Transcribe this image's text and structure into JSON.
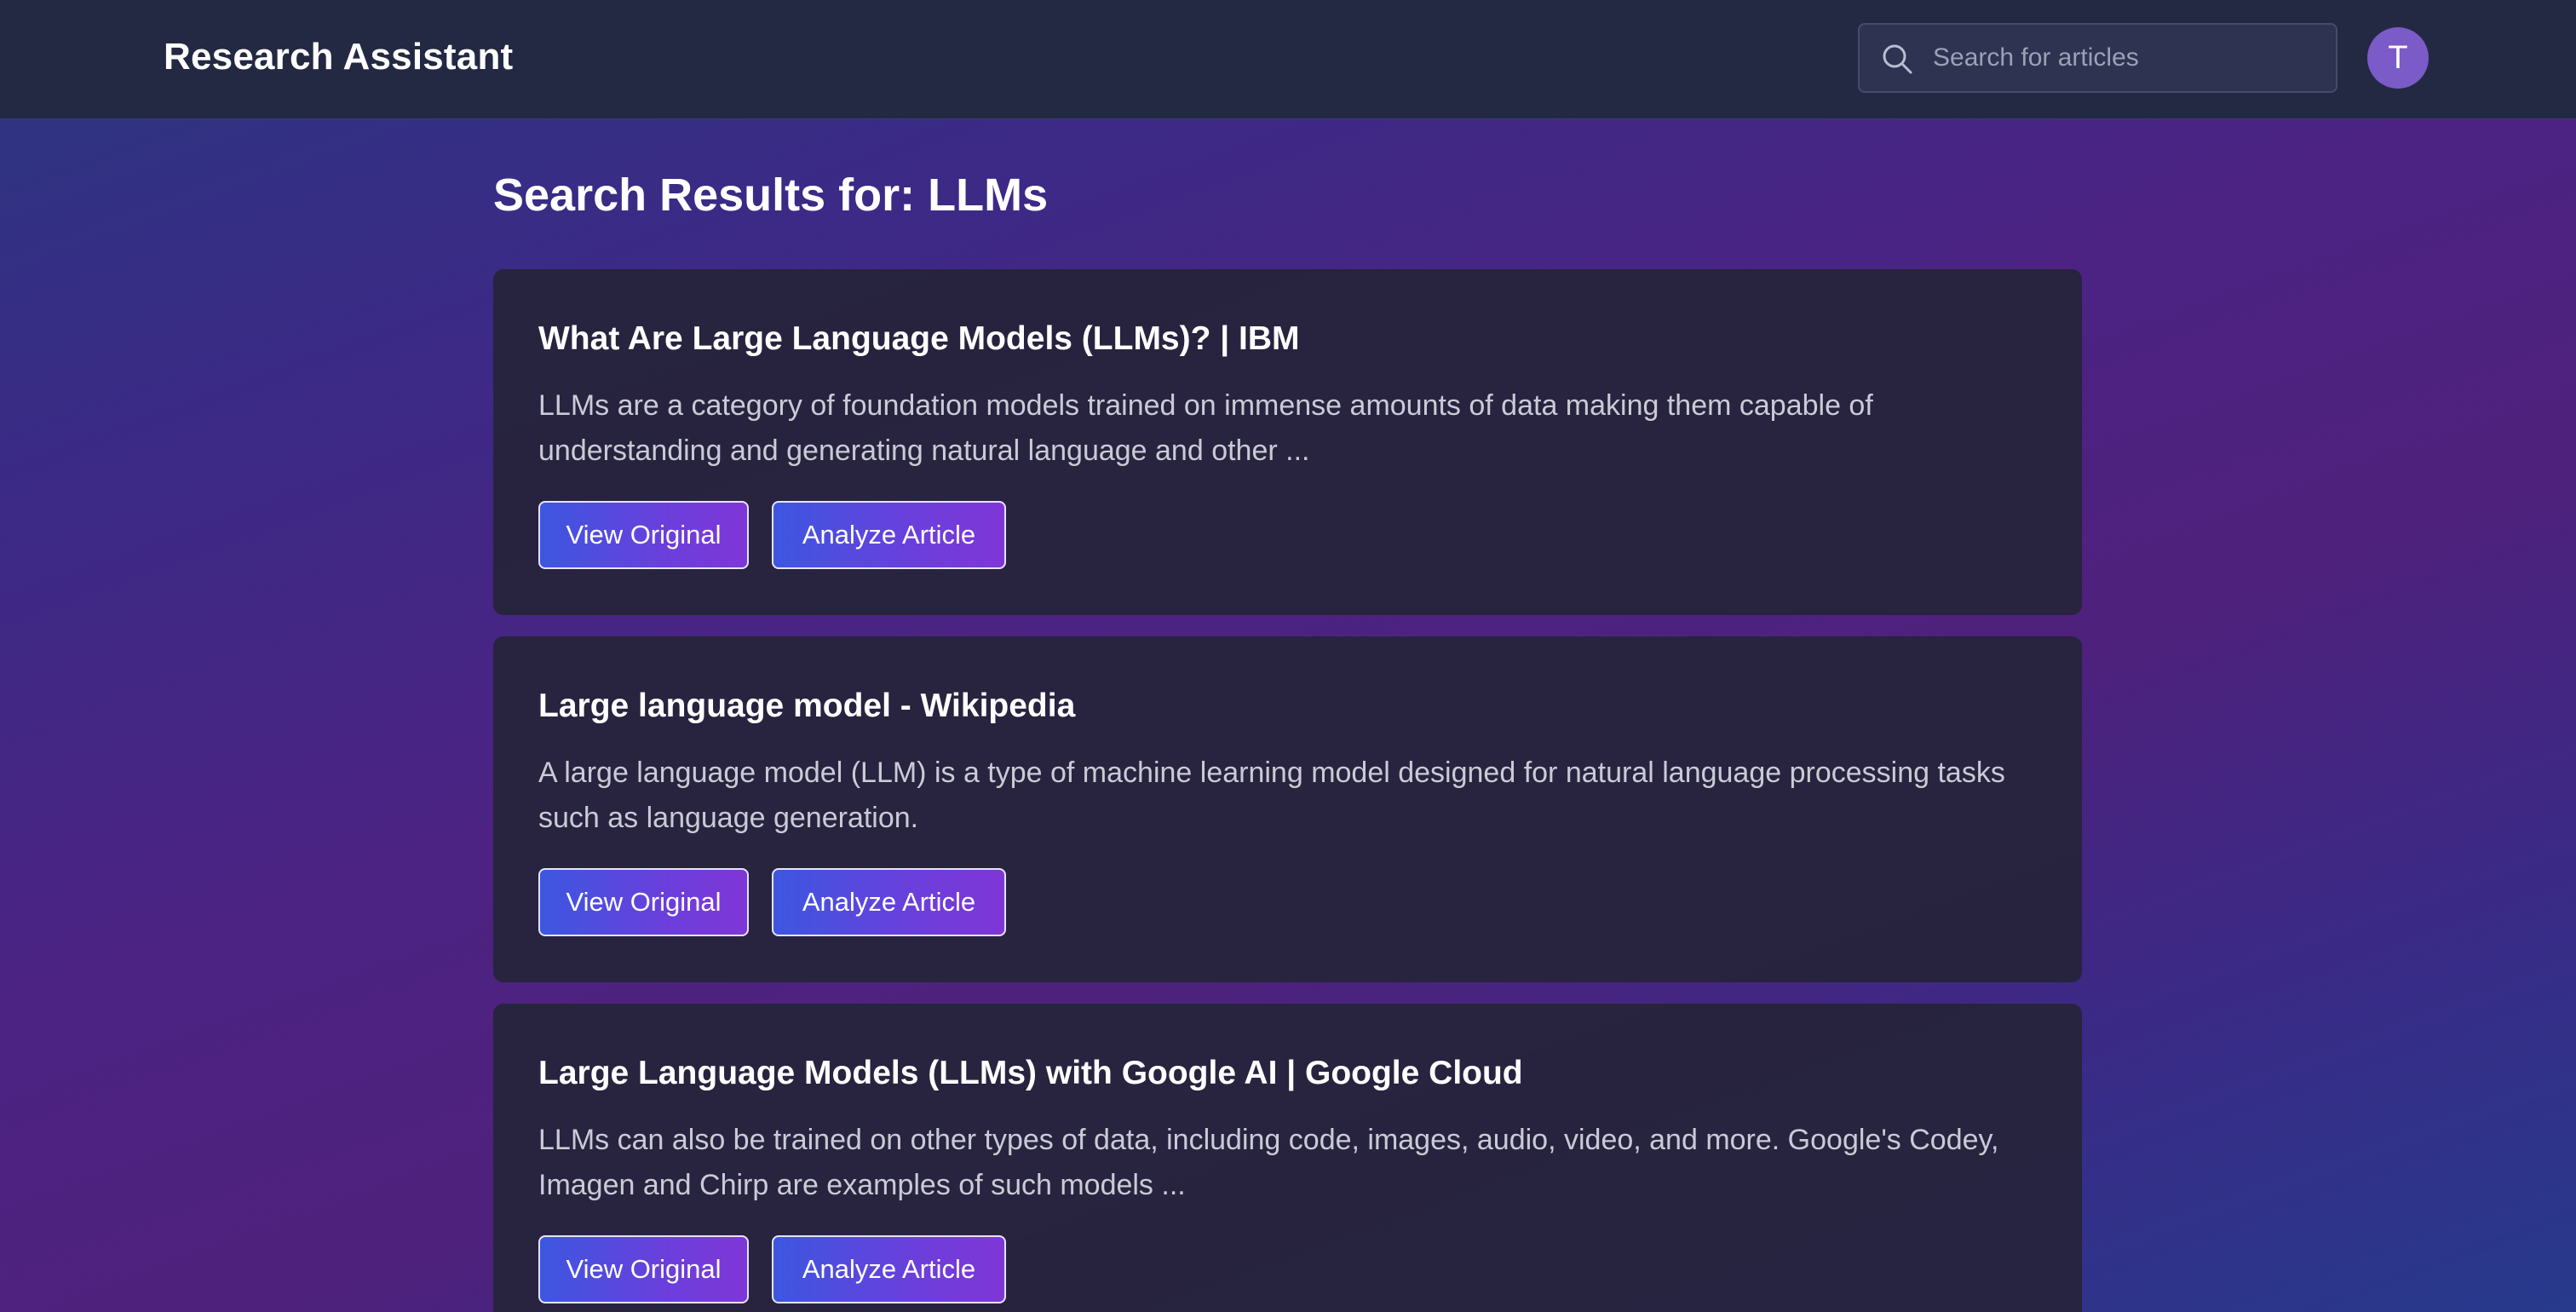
{
  "header": {
    "brand": "Research Assistant",
    "search_placeholder": "Search for articles",
    "avatar_initial": "T"
  },
  "page": {
    "title": "Search Results for: LLMs"
  },
  "results": [
    {
      "title": "What Are Large Language Models (LLMs)? | IBM",
      "snippet": "LLMs are a category of foundation models trained on immense amounts of data making them capable of understanding and generating natural language and other ...",
      "view_label": "View Original",
      "analyze_label": "Analyze Article"
    },
    {
      "title": "Large language model - Wikipedia",
      "snippet": "A large language model (LLM) is a type of machine learning model designed for natural language processing tasks such as language generation.",
      "view_label": "View Original",
      "analyze_label": "Analyze Article"
    },
    {
      "title": "Large Language Models (LLMs) with Google AI | Google Cloud",
      "snippet": "LLMs can also be trained on other types of data, including code, images, audio, video, and more. Google's Codey, Imagen and Chirp are examples of such models ...",
      "view_label": "View Original",
      "analyze_label": "Analyze Article"
    }
  ],
  "colors": {
    "header_bg": "#232943",
    "card_bg": "#26243a",
    "button_gradient_start": "#3c57e0",
    "button_gradient_end": "#7f36d6",
    "avatar_bg": "#7a5bc7"
  },
  "icons": {
    "search": "search-icon"
  }
}
